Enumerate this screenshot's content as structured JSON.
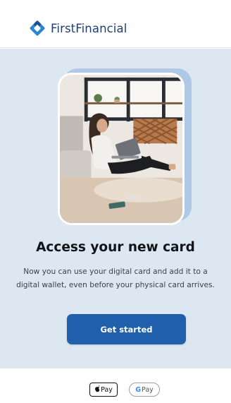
{
  "header": {
    "brand_name": "FirstFinancial",
    "logo_icon": "diamond-logo-icon",
    "brand_color": "#1e3f73"
  },
  "hero": {
    "image_icon": "woman-with-laptop-photo"
  },
  "main": {
    "title": "Access your new card",
    "description_line1": "Now you can use your digital card and add it to a",
    "description_line2": "digital wallet, even before your physical card arrives.",
    "cta_label": "Get started",
    "cta_color": "#1f5fab",
    "background_color": "#dde7f2"
  },
  "footer": {
    "apple_pay_label": "Pay",
    "google_pay_label": "Pay",
    "google_mark": "G"
  }
}
